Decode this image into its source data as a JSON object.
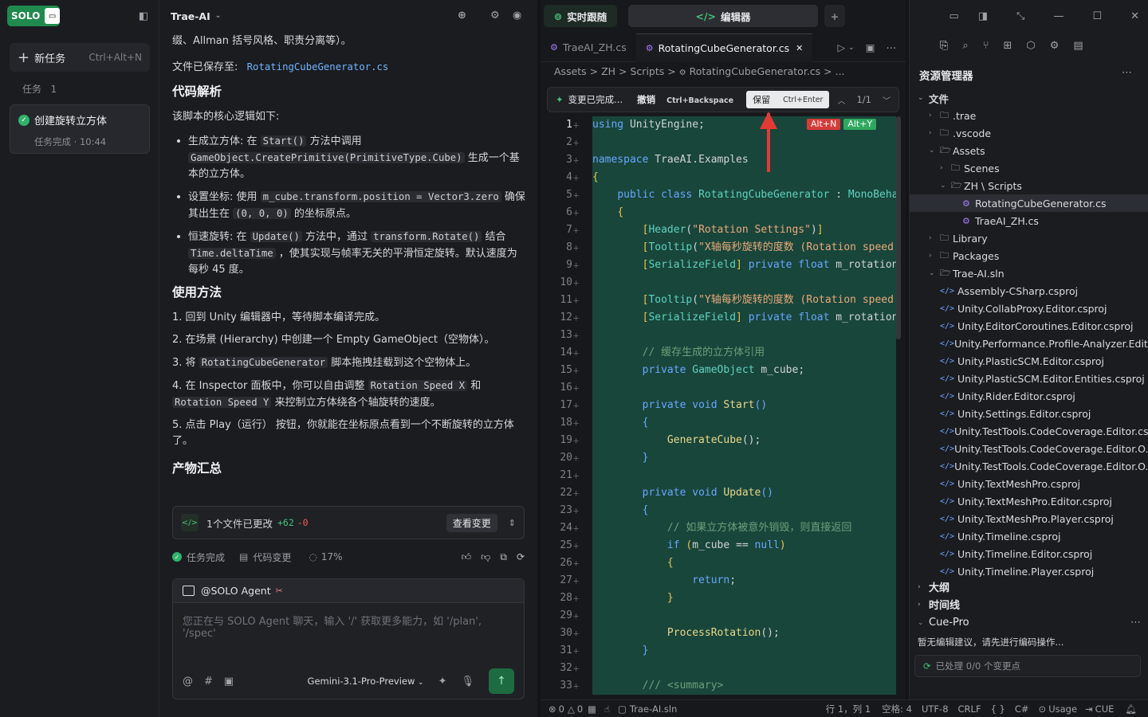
{
  "sidebar": {
    "logo": "SOLO",
    "new_task_label": "新任务",
    "new_task_shortcut": "Ctrl+Alt+N",
    "tasks_header": "任务",
    "tasks_count": "1",
    "task": {
      "title": "创建旋转立方体",
      "status": "任务完成 · 10:44"
    }
  },
  "chat": {
    "header_title": "Trae-AI",
    "intro_partial": "缀、Allman 括号风格、职责分离等）。",
    "saved_label": "文件已保存至:",
    "saved_file": "RotatingCubeGenerator.cs",
    "analysis_heading": "代码解析",
    "analysis_intro": "该脚本的核心逻辑如下:",
    "bullets": [
      {
        "p1": "生成立方体: 在 ",
        "c1": "Start()",
        "p2": " 方法中调用 ",
        "c2": "GameObject.CreatePrimitive(PrimitiveType.Cube)",
        "p3": " 生成一个基本的立方体。"
      },
      {
        "p1": "设置坐标: 使用 ",
        "c1": "m_cube.transform.position = Vector3.zero",
        "p2": " 确保其出生在 ",
        "c2": "(0, 0, 0)",
        "p3": " 的坐标原点。"
      },
      {
        "p1": "恒速旋转: 在 ",
        "c1": "Update()",
        "p2": " 方法中，通过 ",
        "c2": "transform.Rotate()",
        "p3": " 结合 ",
        "c3": "Time.deltaTime",
        "p4": " ，使其实现与帧率无关的平滑恒定旋转。默认速度为每秒 45 度。"
      }
    ],
    "usage_heading": "使用方法",
    "steps": [
      {
        "n": "1.",
        "text": "回到 Unity 编辑器中，等待脚本编译完成。"
      },
      {
        "n": "2.",
        "text": "在场景 (Hierarchy) 中创建一个 Empty GameObject（空物体）。"
      },
      {
        "n": "3.",
        "pre": "将 ",
        "code": "RotatingCubeGenerator",
        "post": " 脚本拖拽挂载到这个空物体上。"
      },
      {
        "n": "4.",
        "pre": "在 Inspector 面板中，你可以自由调整 ",
        "code": "Rotation Speed X",
        "mid": " 和 ",
        "code2": "Rotation Speed Y",
        "post": " 来控制立方体绕各个轴旋转的速度。"
      },
      {
        "n": "5.",
        "text": "点击 Play（运行） 按钮，你就能在坐标原点看到一个不断旋转的立方体了。"
      }
    ],
    "summary_heading": "产物汇总",
    "changes": {
      "label": "1个文件已更改",
      "plus": "+62",
      "minus": "-0",
      "view_button": "查看变更"
    },
    "status": {
      "done": "任务完成",
      "code_changes": "代码变更",
      "progress": "17%"
    },
    "composer": {
      "agent": "@SOLO Agent",
      "placeholder": "您正在与 SOLO Agent 聊天，输入 '/' 获取更多能力，如 '/plan', '/spec'",
      "model": "Gemini-3.1-Pro-Preview"
    }
  },
  "editor": {
    "mode_tabs": [
      "实时跟随",
      "编辑器"
    ],
    "file_tabs": [
      "TraeAI_ZH.cs",
      "RotatingCubeGenerator.cs"
    ],
    "breadcrumb": [
      "Assets",
      "ZH",
      "Scripts",
      "RotatingCubeGenerator.cs",
      "..."
    ],
    "diff_bar": {
      "status": "变更已完成...",
      "undo": "撤销",
      "undo_key": "Ctrl+Backspace",
      "keep": "保留",
      "keep_key": "Ctrl+Enter",
      "counter": "1/1"
    },
    "inline_keys": [
      "Alt+N",
      "Alt+Y"
    ],
    "lines": [
      {
        "n": "1",
        "html": "<span class='kw'>using</span> UnityEngine;"
      },
      {
        "n": "2",
        "html": ""
      },
      {
        "n": "3",
        "html": "<span class='kw'>namespace</span> TraeAI.Examples"
      },
      {
        "n": "4",
        "html": "<span class='br'>{</span>"
      },
      {
        "n": "5",
        "html": "    <span class='kw'>public class</span> <span class='ty'>RotatingCubeGenerator</span> : <span class='ty'>MonoBehaviour</span>"
      },
      {
        "n": "6",
        "html": "    <span class='br'>{</span>"
      },
      {
        "n": "7",
        "html": "        <span class='br'>[</span><span class='ty'>Header</span>(<span class='str'>\"Rotation Settings\"</span>)<span class='br'>]</span>"
      },
      {
        "n": "8",
        "html": "        <span class='br'>[</span><span class='ty'>Tooltip</span>(<span class='str'>\"X轴每秒旋转的度数 (Rotation speed</span>"
      },
      {
        "n": "9",
        "html": "        <span class='br'>[</span><span class='ty'>SerializeField</span><span class='br'>]</span> <span class='kw'>private float</span> m_rotationSpeedX"
      },
      {
        "n": "10",
        "html": ""
      },
      {
        "n": "11",
        "html": "        <span class='br'>[</span><span class='ty'>Tooltip</span>(<span class='str'>\"Y轴每秒旋转的度数 (Rotation speed</span>"
      },
      {
        "n": "12",
        "html": "        <span class='br'>[</span><span class='ty'>SerializeField</span><span class='br'>]</span> <span class='kw'>private float</span> m_rotationSpeedY"
      },
      {
        "n": "13",
        "html": ""
      },
      {
        "n": "14",
        "html": "        <span class='cm'>// 缓存生成的立方体引用</span>"
      },
      {
        "n": "15",
        "html": "        <span class='kw'>private</span> <span class='ty'>GameObject</span> m_cube;"
      },
      {
        "n": "16",
        "html": ""
      },
      {
        "n": "17",
        "html": "        <span class='kw'>private void</span> <span class='fn'>Start</span><span class='kw'>()</span>"
      },
      {
        "n": "18",
        "html": "        <span class='kw'>{</span>"
      },
      {
        "n": "19",
        "html": "            <span class='fn'>GenerateCube</span>();"
      },
      {
        "n": "20",
        "html": "        <span class='kw'>}</span>"
      },
      {
        "n": "21",
        "html": ""
      },
      {
        "n": "22",
        "html": "        <span class='kw'>private void</span> <span class='fn'>Update</span><span class='kw'>()</span>"
      },
      {
        "n": "23",
        "html": "        <span class='kw'>{</span>"
      },
      {
        "n": "24",
        "html": "            <span class='cm'>// 如果立方体被意外销毁，则直接返回</span>"
      },
      {
        "n": "25",
        "html": "            <span class='kw'>if</span> <span class='br'>(</span>m_cube == <span class='kw'>null</span><span class='br'>)</span>"
      },
      {
        "n": "26",
        "html": "            <span class='br'>{</span>"
      },
      {
        "n": "27",
        "html": "                <span class='kw'>return</span>;"
      },
      {
        "n": "28",
        "html": "            <span class='br'>}</span>"
      },
      {
        "n": "29",
        "html": ""
      },
      {
        "n": "30",
        "html": "            <span class='fn'>ProcessRotation</span>();"
      },
      {
        "n": "31",
        "html": "        <span class='kw'>}</span>"
      },
      {
        "n": "32",
        "html": ""
      },
      {
        "n": "33",
        "html": "        <span class='cm'>/// &lt;summary&gt;</span>"
      }
    ]
  },
  "explorer": {
    "title": "资源管理器",
    "root": "文件",
    "items": [
      {
        "label": ".trae",
        "depth": 1,
        "kind": "folder",
        "open": false
      },
      {
        "label": ".vscode",
        "depth": 1,
        "kind": "folder",
        "open": false
      },
      {
        "label": "Assets",
        "depth": 1,
        "kind": "folder",
        "open": true
      },
      {
        "label": "Scenes",
        "depth": 2,
        "kind": "folder",
        "open": false
      },
      {
        "label": "ZH \\ Scripts",
        "depth": 2,
        "kind": "folder",
        "open": true
      },
      {
        "label": "RotatingCubeGenerator.cs",
        "depth": 3,
        "kind": "cs",
        "selected": true
      },
      {
        "label": "TraeAI_ZH.cs",
        "depth": 3,
        "kind": "cs"
      },
      {
        "label": "Library",
        "depth": 1,
        "kind": "folder",
        "open": false
      },
      {
        "label": "Packages",
        "depth": 1,
        "kind": "folder",
        "open": false
      },
      {
        "label": "Trae-AI.sln",
        "depth": 1,
        "kind": "folder",
        "open": true
      },
      {
        "label": "Assembly-CSharp.csproj",
        "depth": 2,
        "kind": "proj"
      },
      {
        "label": "Unity.CollabProxy.Editor.csproj",
        "depth": 2,
        "kind": "proj"
      },
      {
        "label": "Unity.EditorCoroutines.Editor.csproj",
        "depth": 2,
        "kind": "proj"
      },
      {
        "label": "Unity.Performance.Profile-Analyzer.Edit...",
        "depth": 2,
        "kind": "proj"
      },
      {
        "label": "Unity.PlasticSCM.Editor.csproj",
        "depth": 2,
        "kind": "proj"
      },
      {
        "label": "Unity.PlasticSCM.Editor.Entities.csproj",
        "depth": 2,
        "kind": "proj"
      },
      {
        "label": "Unity.Rider.Editor.csproj",
        "depth": 2,
        "kind": "proj"
      },
      {
        "label": "Unity.Settings.Editor.csproj",
        "depth": 2,
        "kind": "proj"
      },
      {
        "label": "Unity.TestTools.CodeCoverage.Editor.cs...",
        "depth": 2,
        "kind": "proj"
      },
      {
        "label": "Unity.TestTools.CodeCoverage.Editor.O...",
        "depth": 2,
        "kind": "proj"
      },
      {
        "label": "Unity.TestTools.CodeCoverage.Editor.O...",
        "depth": 2,
        "kind": "proj"
      },
      {
        "label": "Unity.TextMeshPro.csproj",
        "depth": 2,
        "kind": "proj"
      },
      {
        "label": "Unity.TextMeshPro.Editor.csproj",
        "depth": 2,
        "kind": "proj"
      },
      {
        "label": "Unity.TextMeshPro.Player.csproj",
        "depth": 2,
        "kind": "proj"
      },
      {
        "label": "Unity.Timeline.csproj",
        "depth": 2,
        "kind": "proj"
      },
      {
        "label": "Unity.Timeline.Editor.csproj",
        "depth": 2,
        "kind": "proj"
      },
      {
        "label": "Unity.Timeline.Player.csproj",
        "depth": 2,
        "kind": "proj"
      }
    ],
    "outline": "大纲",
    "timeline": "时间线",
    "cue_title": "Cue-Pro",
    "cue_text": "暂无编辑建议，请先进行编码操作...",
    "cue_status": "已处理 0/0 个变更点"
  },
  "statusbar": {
    "errors": "0",
    "warnings": "0",
    "project": "Trae-AI.sln",
    "position": "行 1，列 1",
    "spaces": "空格: 4",
    "encoding": "UTF-8",
    "eol": "CRLF",
    "braces": "{ }",
    "lang": "C#",
    "usage": "Usage",
    "cue": "CUE"
  }
}
